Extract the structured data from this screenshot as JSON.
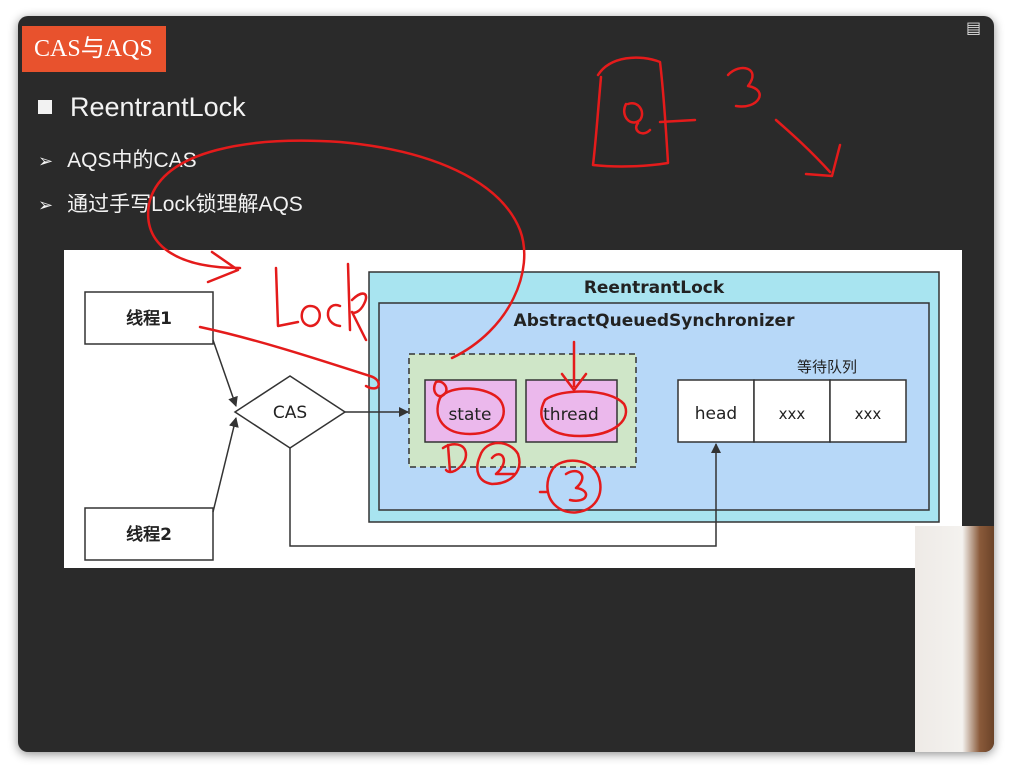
{
  "slide": {
    "tag": "CAS与AQS",
    "bullets": [
      "ReentrantLock",
      "AQS中的CAS",
      "通过手写Lock锁理解AQS"
    ],
    "bullet_marker": "➢"
  },
  "diagram": {
    "thread1": "线程1",
    "thread2": "线程2",
    "cas": "CAS",
    "outer_title": "ReentrantLock",
    "inner_title": "AbstractQueuedSynchronizer",
    "fields": [
      "state",
      "thread"
    ],
    "queue_label": "等待队列",
    "queue_cells": [
      "head",
      "xxx",
      "xxx"
    ],
    "colors": {
      "outer_fill": "#a8e4f0",
      "inner_fill": "#b7d8f8",
      "field_group_fill": "#cfe6c8",
      "field_fill": "#ebb8ec",
      "queue_fill": "#ffffff",
      "annotation_red": "#e41b1b"
    }
  },
  "annotations": {
    "handwriting": [
      "LOCK",
      "0",
      "3",
      "0",
      "1",
      "2",
      "3"
    ]
  },
  "icons": {
    "window_corner": "window-icon"
  }
}
